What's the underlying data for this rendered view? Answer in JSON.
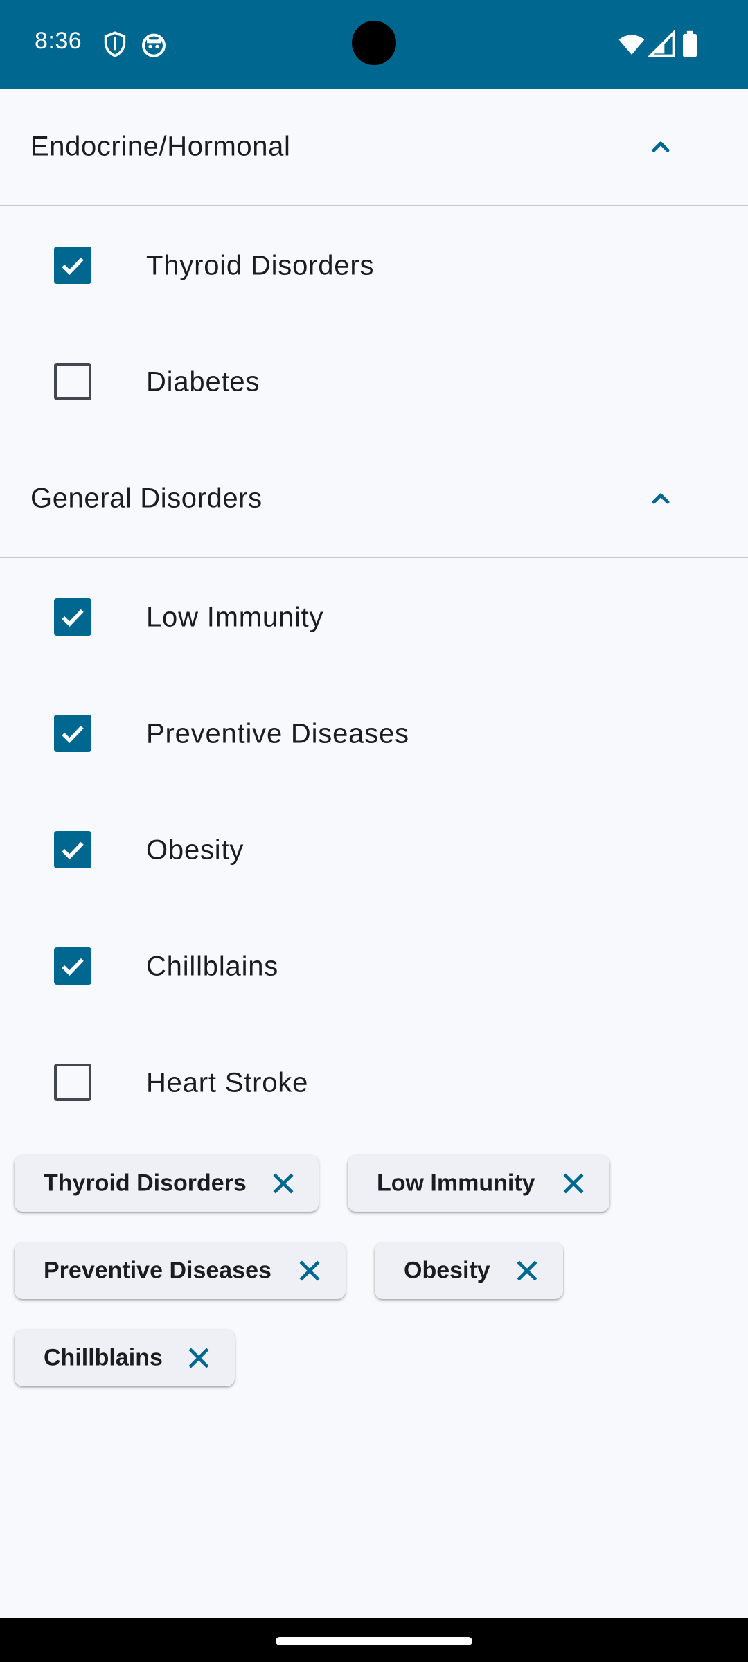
{
  "status_bar": {
    "time": "8:36",
    "background": "#006890",
    "icons": [
      "shield-icon",
      "android-face-icon",
      "wifi-icon",
      "signal-icon",
      "battery-icon"
    ]
  },
  "sections": [
    {
      "title": "Endocrine/Hormonal",
      "expanded": true,
      "items": [
        {
          "label": "Thyroid Disorders",
          "checked": true
        },
        {
          "label": "Diabetes",
          "checked": false
        }
      ]
    },
    {
      "title": "General Disorders",
      "expanded": true,
      "items": [
        {
          "label": "Low Immunity",
          "checked": true
        },
        {
          "label": "Preventive Diseases",
          "checked": true
        },
        {
          "label": "Obesity",
          "checked": true
        },
        {
          "label": "Chillblains",
          "checked": true
        },
        {
          "label": "Heart Stroke",
          "checked": false
        }
      ]
    }
  ],
  "chips": [
    {
      "label": "Thyroid Disorders"
    },
    {
      "label": "Low Immunity"
    },
    {
      "label": "Preventive Diseases"
    },
    {
      "label": "Obesity"
    },
    {
      "label": "Chillblains"
    }
  ],
  "colors": {
    "accent": "#006890",
    "background": "#f8f9fd",
    "text": "#1a1c1e",
    "chip_background": "#eef0f6"
  }
}
